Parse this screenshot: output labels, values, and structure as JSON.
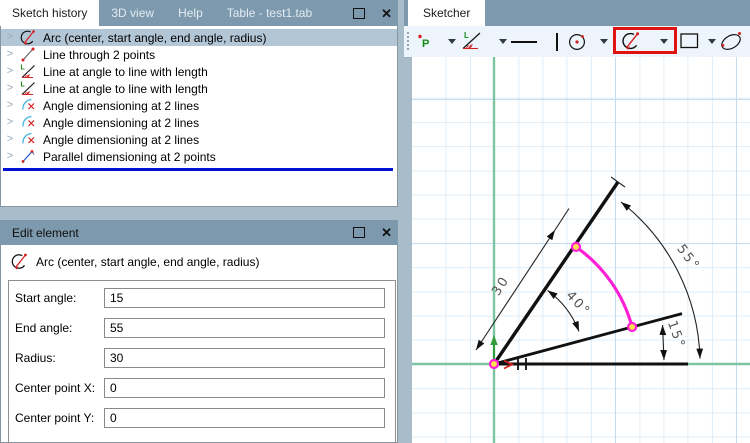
{
  "colors": {
    "titlebar": "#7d99ad",
    "window_background": "#a8bcc9",
    "selection": "#b3c6d6",
    "insertion_line": "#0011d6",
    "highlight_box": "#e01212",
    "axis_green": "#7cc5a0",
    "sketch_magenta": "#ff1fd6",
    "grid_minor": "#dfecf7",
    "grid_major": "#c3dcef"
  },
  "sketch_history": {
    "tabs": [
      {
        "label": "Sketch history",
        "active": true
      },
      {
        "label": "3D view",
        "active": false
      },
      {
        "label": "Help",
        "active": false
      },
      {
        "label": "Table - test1.tab",
        "active": false
      }
    ],
    "items": [
      {
        "icon": "arc-icon",
        "label": "Arc (center, start angle, end angle, radius)",
        "selected": true
      },
      {
        "icon": "line-icon",
        "label": "Line through 2 points",
        "selected": false
      },
      {
        "icon": "line-angle-icon",
        "label": "Line at angle to line with length",
        "selected": false
      },
      {
        "icon": "line-angle-icon",
        "label": "Line at angle to line with length",
        "selected": false
      },
      {
        "icon": "angle-dim-icon",
        "label": "Angle dimensioning at 2 lines",
        "selected": false
      },
      {
        "icon": "angle-dim-icon",
        "label": "Angle dimensioning at 2 lines",
        "selected": false
      },
      {
        "icon": "angle-dim-icon",
        "label": "Angle dimensioning at 2 lines",
        "selected": false
      },
      {
        "icon": "parallel-dim-icon",
        "label": "Parallel dimensioning at 2 points",
        "selected": false
      }
    ]
  },
  "edit_element": {
    "title": "Edit element",
    "element_type": {
      "icon": "arc-icon",
      "label": "Arc (center, start angle, end angle, radius)"
    },
    "fields": [
      {
        "label": "Start angle:",
        "value": "15"
      },
      {
        "label": "End angle:",
        "value": "55"
      },
      {
        "label": "Radius:",
        "value": "30"
      },
      {
        "label": "Center point X:",
        "value": "0"
      },
      {
        "label": "Center point Y:",
        "value": "0"
      }
    ]
  },
  "sketcher": {
    "tab": "Sketcher",
    "toolbar": {
      "tools": [
        {
          "name": "point-tool",
          "dropdown": true
        },
        {
          "name": "line-at-angle-tool",
          "dropdown": true
        },
        {
          "name": "horizontal-line-tool",
          "dropdown": false
        },
        {
          "name": "vertical-line-tool",
          "dropdown": false
        },
        {
          "name": "circle-tool",
          "dropdown": true
        },
        {
          "name": "arc-tool",
          "dropdown": true,
          "highlighted": true
        },
        {
          "name": "rectangle-tool",
          "dropdown": true
        },
        {
          "name": "ellipse-tool",
          "dropdown": false
        }
      ]
    },
    "canvas": {
      "dim_labels": {
        "radius": "30",
        "angle_between": "40°",
        "angle_end": "55°",
        "angle_start": "15°"
      },
      "arc": {
        "start_angle": "15",
        "end_angle": "55",
        "radius": "30",
        "center_x": "0",
        "center_y": "0"
      }
    }
  }
}
